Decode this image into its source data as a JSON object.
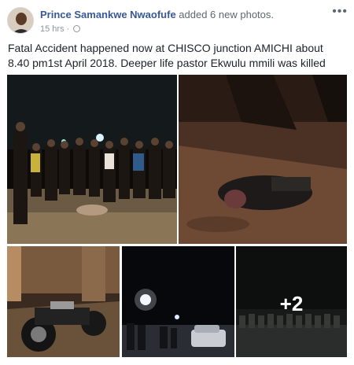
{
  "post": {
    "author_name": "Prince Samankwe Nwaofufe",
    "action": "added 6 new photos.",
    "timestamp": "15 hrs",
    "separator": "·",
    "more_glyph": "•••",
    "text": "Fatal Accident happened now at CHISCO junction AMICHI about 8.40 pm1st April 2018. Deeper life pastor Ekwulu mmili was killed now"
  },
  "photos": {
    "more_count_label": "+2"
  },
  "icons": {
    "privacy": "globe-icon",
    "menu": "more-options-icon"
  }
}
